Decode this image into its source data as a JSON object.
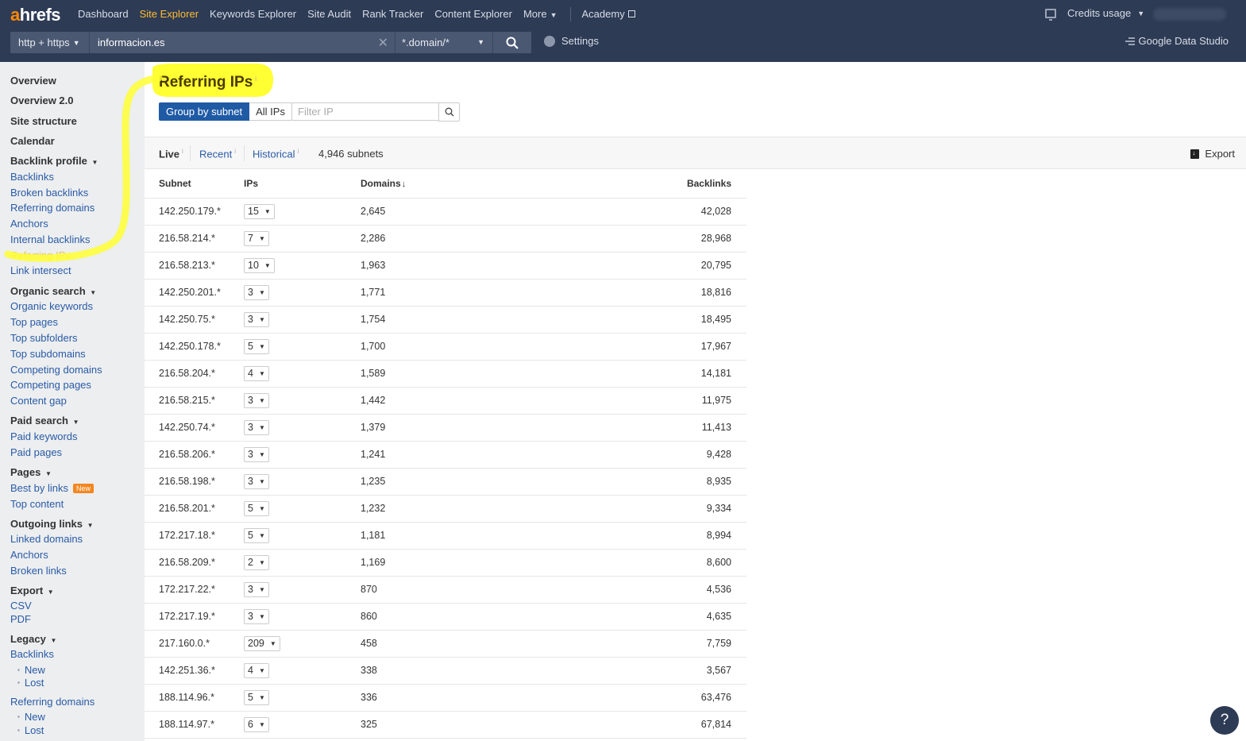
{
  "header": {
    "logo_a": "a",
    "logo_rest": "hrefs",
    "nav": [
      {
        "label": "Dashboard"
      },
      {
        "label": "Site Explorer",
        "active": true
      },
      {
        "label": "Keywords Explorer"
      },
      {
        "label": "Site Audit"
      },
      {
        "label": "Rank Tracker"
      },
      {
        "label": "Content Explorer"
      },
      {
        "label": "More"
      }
    ],
    "academy": "Academy",
    "credits": "Credits usage",
    "protocol": "http + https",
    "url_value": "informacion.es",
    "mode": "*.domain/*",
    "settings": "Settings",
    "gds": "Google Data Studio"
  },
  "sidebar": {
    "top": [
      "Overview",
      "Overview 2.0",
      "Site structure",
      "Calendar"
    ],
    "backlink_profile": {
      "title": "Backlink profile",
      "items": [
        "Backlinks",
        "Broken backlinks",
        "Referring domains",
        "Anchors",
        "Internal backlinks",
        "Referring IPs",
        "Link intersect"
      ]
    },
    "organic_search": {
      "title": "Organic search",
      "items": [
        "Organic keywords",
        "Top pages",
        "Top subfolders",
        "Top subdomains",
        "Competing domains",
        "Competing pages",
        "Content gap"
      ]
    },
    "paid_search": {
      "title": "Paid search",
      "items": [
        "Paid keywords",
        "Paid pages"
      ]
    },
    "pages": {
      "title": "Pages",
      "items": [
        "Best by links",
        "Top content"
      ],
      "badge": "New"
    },
    "outgoing_links": {
      "title": "Outgoing links",
      "items": [
        "Linked domains",
        "Anchors",
        "Broken links"
      ]
    },
    "export": {
      "title": "Export",
      "items": [
        "CSV",
        "PDF"
      ]
    },
    "legacy": {
      "title": "Legacy",
      "backlinks": "Backlinks",
      "referring_domains": "Referring domains",
      "new": "New",
      "lost": "Lost"
    }
  },
  "main": {
    "title": "Referring IPs",
    "info": "i",
    "group_by_subnet": "Group by subnet",
    "all_ips": "All IPs",
    "filter_placeholder": "Filter IP",
    "tabs": {
      "live": "Live",
      "recent": "Recent",
      "historical": "Historical"
    },
    "count": "4,946 subnets",
    "export": "Export",
    "columns": {
      "subnet": "Subnet",
      "ips": "IPs",
      "domains": "Domains",
      "backlinks": "Backlinks"
    },
    "rows": [
      {
        "subnet": "142.250.179.*",
        "ips": "15",
        "domains": "2,645",
        "backlinks": "42,028"
      },
      {
        "subnet": "216.58.214.*",
        "ips": "7",
        "domains": "2,286",
        "backlinks": "28,968"
      },
      {
        "subnet": "216.58.213.*",
        "ips": "10",
        "domains": "1,963",
        "backlinks": "20,795"
      },
      {
        "subnet": "142.250.201.*",
        "ips": "3",
        "domains": "1,771",
        "backlinks": "18,816"
      },
      {
        "subnet": "142.250.75.*",
        "ips": "3",
        "domains": "1,754",
        "backlinks": "18,495"
      },
      {
        "subnet": "142.250.178.*",
        "ips": "5",
        "domains": "1,700",
        "backlinks": "17,967"
      },
      {
        "subnet": "216.58.204.*",
        "ips": "4",
        "domains": "1,589",
        "backlinks": "14,181"
      },
      {
        "subnet": "216.58.215.*",
        "ips": "3",
        "domains": "1,442",
        "backlinks": "11,975"
      },
      {
        "subnet": "142.250.74.*",
        "ips": "3",
        "domains": "1,379",
        "backlinks": "11,413"
      },
      {
        "subnet": "216.58.206.*",
        "ips": "3",
        "domains": "1,241",
        "backlinks": "9,428"
      },
      {
        "subnet": "216.58.198.*",
        "ips": "3",
        "domains": "1,235",
        "backlinks": "8,935"
      },
      {
        "subnet": "216.58.201.*",
        "ips": "5",
        "domains": "1,232",
        "backlinks": "9,334"
      },
      {
        "subnet": "172.217.18.*",
        "ips": "5",
        "domains": "1,181",
        "backlinks": "8,994"
      },
      {
        "subnet": "216.58.209.*",
        "ips": "2",
        "domains": "1,169",
        "backlinks": "8,600"
      },
      {
        "subnet": "172.217.22.*",
        "ips": "3",
        "domains": "870",
        "backlinks": "4,536"
      },
      {
        "subnet": "172.217.19.*",
        "ips": "3",
        "domains": "860",
        "backlinks": "4,635"
      },
      {
        "subnet": "217.160.0.*",
        "ips": "209",
        "domains": "458",
        "backlinks": "7,759"
      },
      {
        "subnet": "142.251.36.*",
        "ips": "4",
        "domains": "338",
        "backlinks": "3,567"
      },
      {
        "subnet": "188.114.96.*",
        "ips": "5",
        "domains": "336",
        "backlinks": "63,476"
      },
      {
        "subnet": "188.114.97.*",
        "ips": "6",
        "domains": "325",
        "backlinks": "67,814"
      }
    ]
  },
  "help": "?",
  "colors": {
    "topbar": "#2d3b55",
    "accent_active": "#ffbb33",
    "link": "#2a5ba6",
    "primary_button": "#1f5aa5",
    "highlight": "#ffff33",
    "badge": "#f5861f"
  }
}
